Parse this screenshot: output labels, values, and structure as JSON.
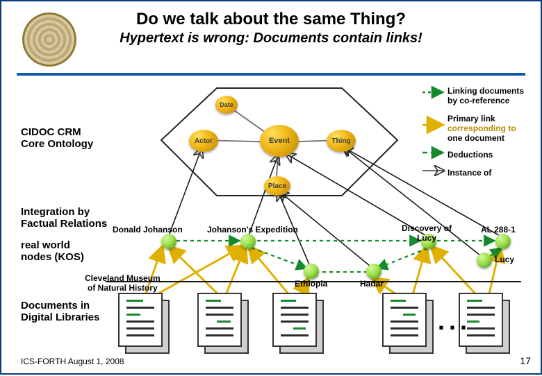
{
  "title": "Do we talk about the same Thing?",
  "subtitle": "Hypertext is wrong: Documents contain links!",
  "labels": {
    "ontology": "CIDOC CRM\nCore Ontology",
    "integration": "Integration by\nFactual Relations",
    "realworld": "real world\nnodes (KOS)",
    "documents": "Documents in\nDigital Libraries"
  },
  "legend": {
    "coref": "Linking documents\nby co-reference",
    "primary_a": "Primary link",
    "primary_b": "corresponding to",
    "primary_c": "one document",
    "deductions": "Deductions",
    "instance": "Instance of"
  },
  "ontology_nodes": {
    "date": "Date",
    "actor": "Actor",
    "event": "Event",
    "thing": "Thing",
    "place": "Place"
  },
  "real_nodes": {
    "johanson": "Donald Johanson",
    "expedition": "Johanson's Expedition",
    "ethiopia": "Ethiopia",
    "hadar": "Hadar",
    "discovery": "Discovery of\nLucy",
    "lucy": "Lucy",
    "al288": "AL 288-1",
    "cleveland": "Cleveland Museum\nof Natural History"
  },
  "footer": "ICS-FORTH  August 1, 2008",
  "page": "17"
}
